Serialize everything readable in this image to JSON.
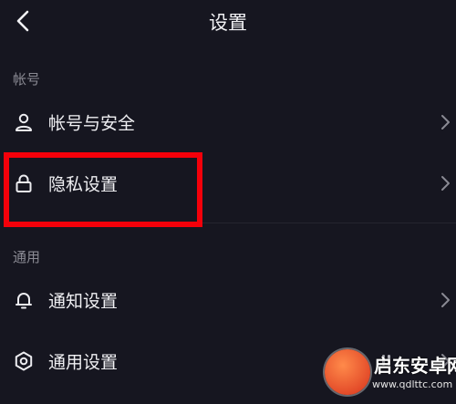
{
  "header": {
    "title": "设置",
    "back_icon": "chevron-left-icon"
  },
  "sections": [
    {
      "label": "帐号",
      "items": [
        {
          "label": "帐号与安全",
          "icon": "user-icon"
        },
        {
          "label": "隐私设置",
          "icon": "lock-icon"
        }
      ]
    },
    {
      "label": "通用",
      "items": [
        {
          "label": "通知设置",
          "icon": "bell-icon"
        },
        {
          "label": "通用设置",
          "icon": "gear-icon"
        }
      ]
    }
  ],
  "watermark": {
    "brand": "启东安卓网",
    "url": "www.qdlttc.com"
  },
  "colors": {
    "background": "#161620",
    "highlight": "#f4000a",
    "text": "#f0f0f3",
    "muted": "#8a8a93"
  }
}
